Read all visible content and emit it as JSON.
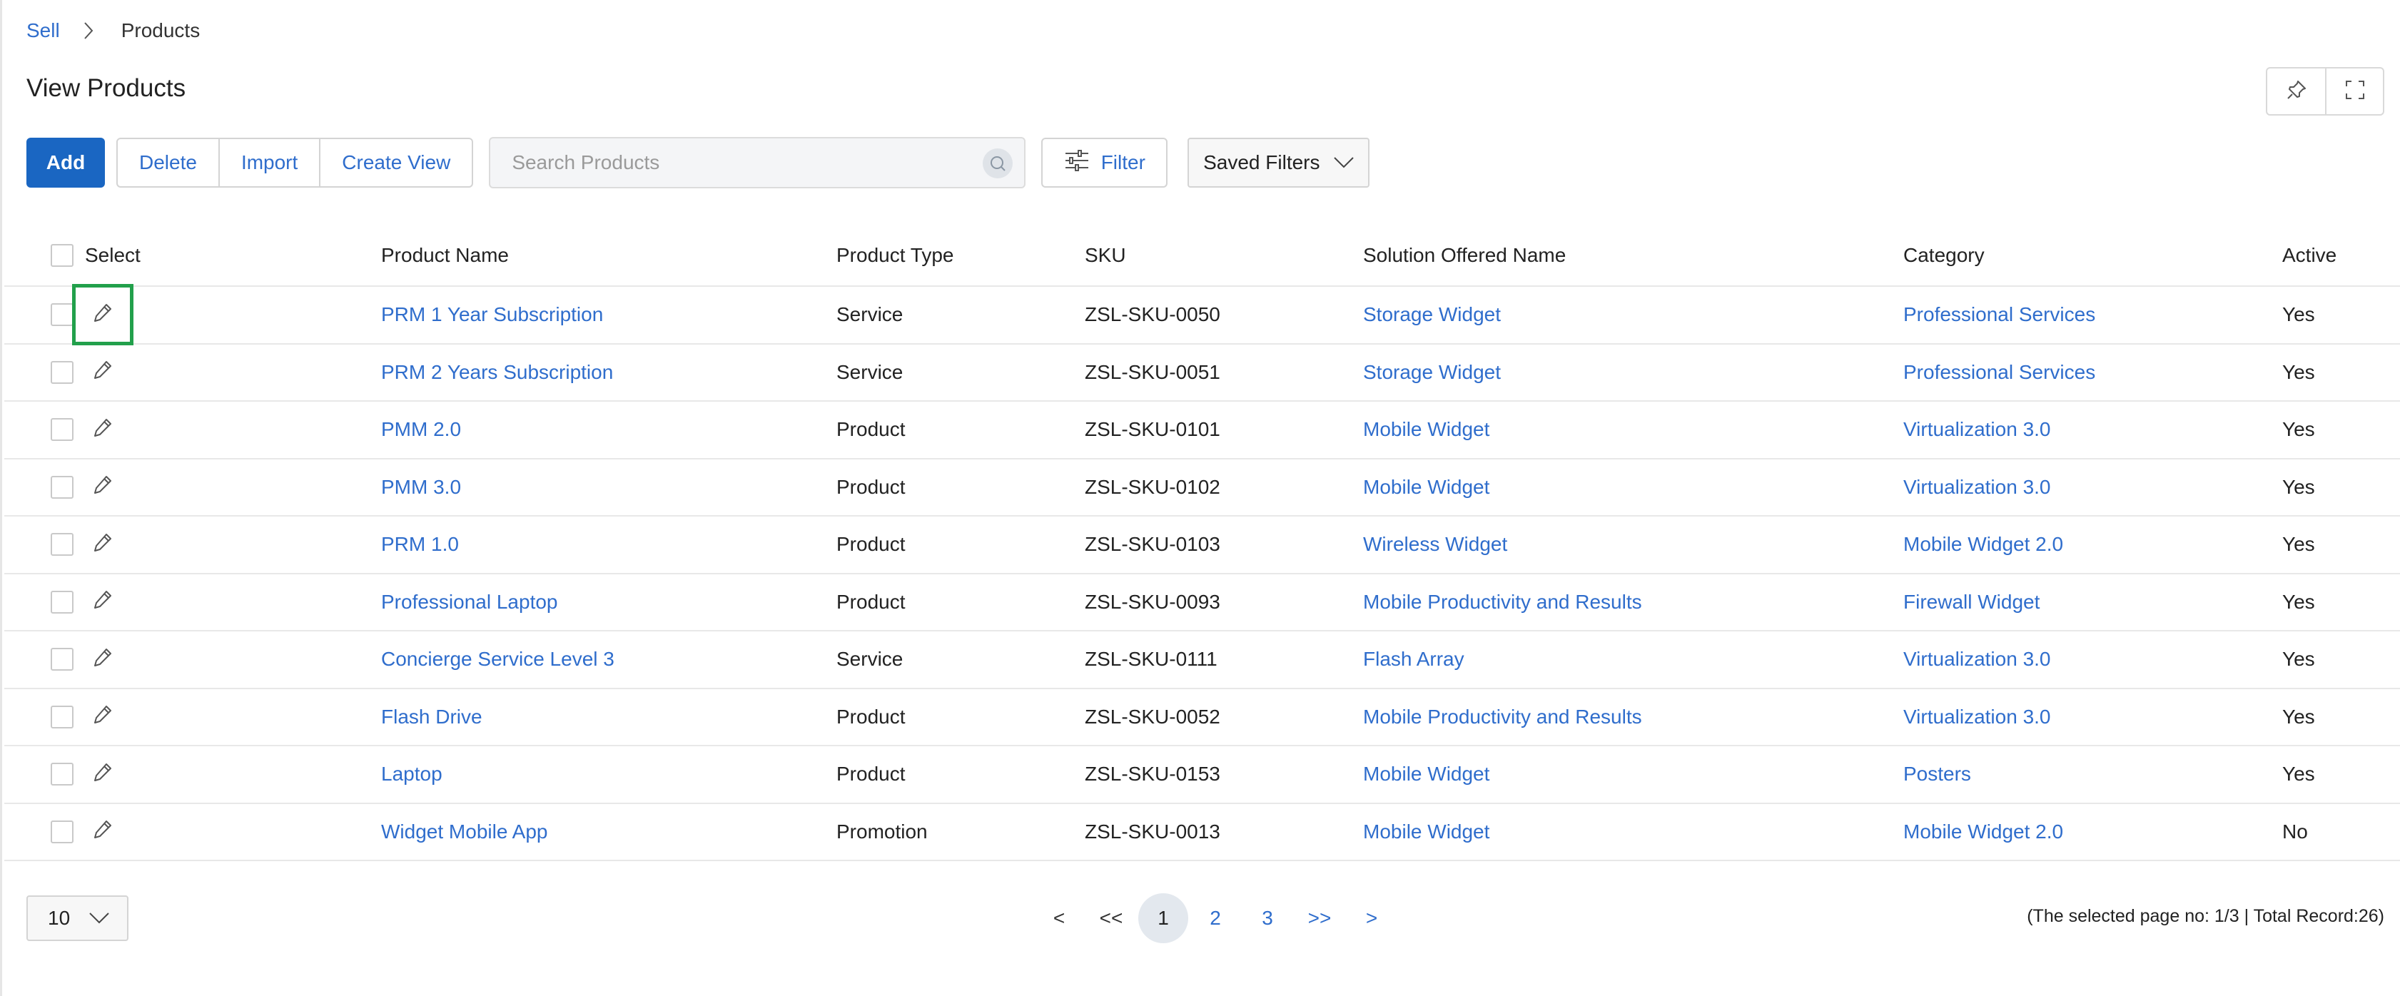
{
  "breadcrumb": {
    "parent": "Sell",
    "current": "Products"
  },
  "page_title": "View Products",
  "toolbar": {
    "add_label": "Add",
    "delete_label": "Delete",
    "import_label": "Import",
    "create_view_label": "Create View",
    "search_placeholder": "Search Products",
    "filter_label": "Filter",
    "saved_filters_label": "Saved Filters"
  },
  "table": {
    "columns": [
      "Select",
      "Product Name",
      "Product Type",
      "SKU",
      "Solution Offered Name",
      "Category",
      "Active"
    ],
    "rows": [
      {
        "name": "PRM 1 Year Subscription",
        "type": "Service",
        "sku": "ZSL-SKU-0050",
        "solution": "Storage Widget",
        "category": "Professional Services",
        "active": "Yes"
      },
      {
        "name": "PRM 2 Years Subscription",
        "type": "Service",
        "sku": "ZSL-SKU-0051",
        "solution": "Storage Widget",
        "category": "Professional Services",
        "active": "Yes"
      },
      {
        "name": "PMM 2.0",
        "type": "Product",
        "sku": "ZSL-SKU-0101",
        "solution": "Mobile Widget",
        "category": "Virtualization 3.0",
        "active": "Yes"
      },
      {
        "name": "PMM 3.0",
        "type": "Product",
        "sku": "ZSL-SKU-0102",
        "solution": "Mobile Widget",
        "category": "Virtualization 3.0",
        "active": "Yes"
      },
      {
        "name": "PRM 1.0",
        "type": "Product",
        "sku": "ZSL-SKU-0103",
        "solution": "Wireless Widget",
        "category": "Mobile Widget 2.0",
        "active": "Yes"
      },
      {
        "name": "Professional Laptop",
        "type": "Product",
        "sku": "ZSL-SKU-0093",
        "solution": "Mobile Productivity and Results",
        "category": "Firewall Widget",
        "active": "Yes"
      },
      {
        "name": "Concierge Service Level 3",
        "type": "Service",
        "sku": "ZSL-SKU-0111",
        "solution": "Flash Array",
        "category": "Virtualization 3.0",
        "active": "Yes"
      },
      {
        "name": "Flash Drive",
        "type": "Product",
        "sku": "ZSL-SKU-0052",
        "solution": "Mobile Productivity and Results",
        "category": "Virtualization 3.0",
        "active": "Yes"
      },
      {
        "name": "Laptop",
        "type": "Product",
        "sku": "ZSL-SKU-0153",
        "solution": "Mobile Widget",
        "category": "Posters",
        "active": "Yes"
      },
      {
        "name": "Widget Mobile App",
        "type": "Promotion",
        "sku": "ZSL-SKU-0013",
        "solution": "Mobile Widget",
        "category": "Mobile Widget 2.0",
        "active": "No"
      }
    ]
  },
  "pagination": {
    "page_size": "10",
    "prev_label": "<",
    "first_label": "<<",
    "pages": [
      "1",
      "2",
      "3"
    ],
    "current_page": "1",
    "last_label": ">>",
    "next_label": ">",
    "info": "(The selected page no: 1/3 | Total Record:26)"
  },
  "colors": {
    "link": "#2f6dcc",
    "primary": "#1a66c2",
    "highlight": "#22a04b"
  },
  "icons": [
    "chevron-right-icon",
    "pin-icon",
    "fullscreen-icon",
    "search-icon",
    "filter-sliders-icon",
    "chevron-down-icon",
    "edit-pencil-icon"
  ]
}
